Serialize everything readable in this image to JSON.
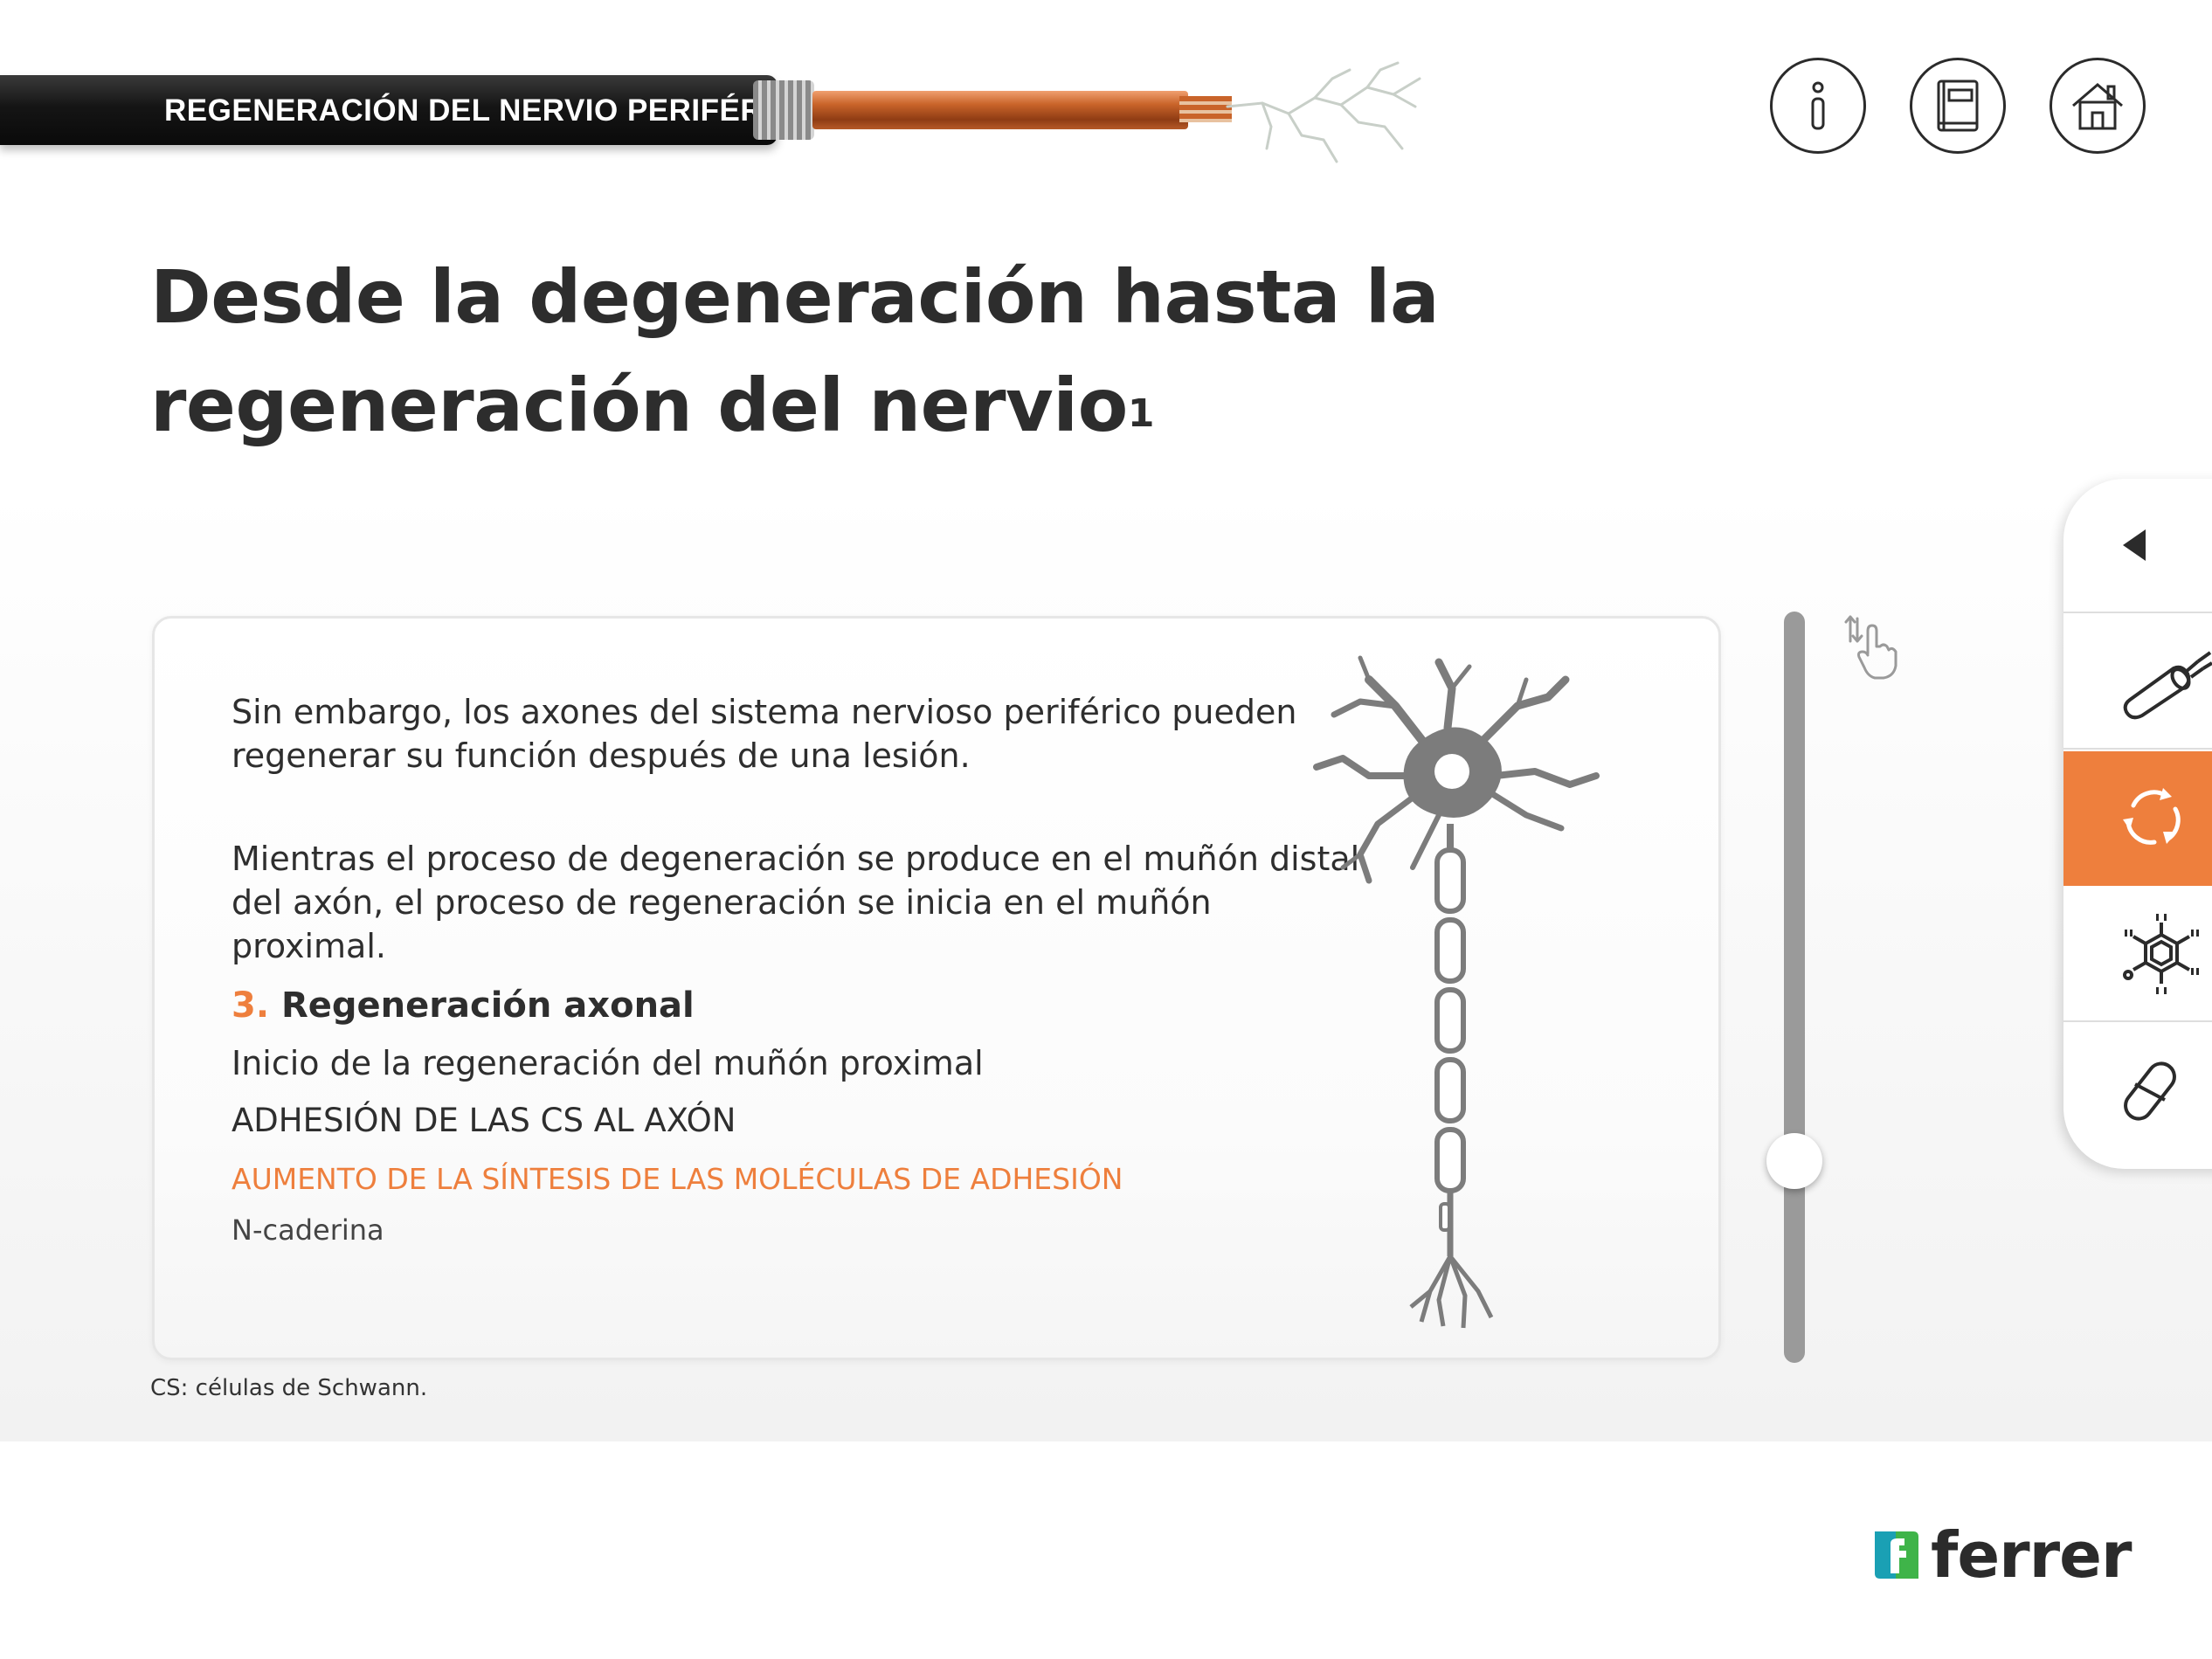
{
  "header": {
    "section_title": "REGENERACIÓN DEL NERVIO PERIFÉRICO",
    "buttons": [
      {
        "icon": "info-icon"
      },
      {
        "icon": "book-icon"
      },
      {
        "icon": "home-icon"
      }
    ]
  },
  "page": {
    "title_line1": "Desde la degeneración hasta la",
    "title_line2": "regeneración del nervio",
    "title_sup": "1"
  },
  "content": {
    "para1_line1": "Sin embargo, los axones del sistema nervioso periférico pueden",
    "para1_line2": "regenerar su función después de una lesión.",
    "para2_line1": "Mientras el proceso de degeneración se produce en el muñón distal",
    "para2_line2": "del axón, el proceso de regeneración se inicia en el muñón proximal.",
    "section_number": "3.",
    "section_heading": "Regeneración axonal",
    "line1": "Inicio de la regeneración del muñón proximal",
    "line2": "ADHESIÓN DE LAS CS AL AXÓN",
    "line3": "AUMENTO DE LA SÍNTESIS DE LAS MOLÉCULAS DE ADHESIÓN",
    "line4": "N-caderina"
  },
  "slider": {
    "position_fraction": 0.75
  },
  "footnote": "CS: células de Schwann.",
  "side_nav": [
    {
      "icon": "back-arrow-icon",
      "active": false
    },
    {
      "icon": "nerve-cable-icon",
      "active": false
    },
    {
      "icon": "cycle-arrows-icon",
      "active": true
    },
    {
      "icon": "molecule-icon",
      "active": false
    },
    {
      "icon": "capsule-icon",
      "active": false
    }
  ],
  "logo": {
    "text": "ferrer"
  },
  "colors": {
    "accent": "#ee7f3d",
    "text": "#2b2b2b",
    "slider": "#9a9a9a"
  }
}
